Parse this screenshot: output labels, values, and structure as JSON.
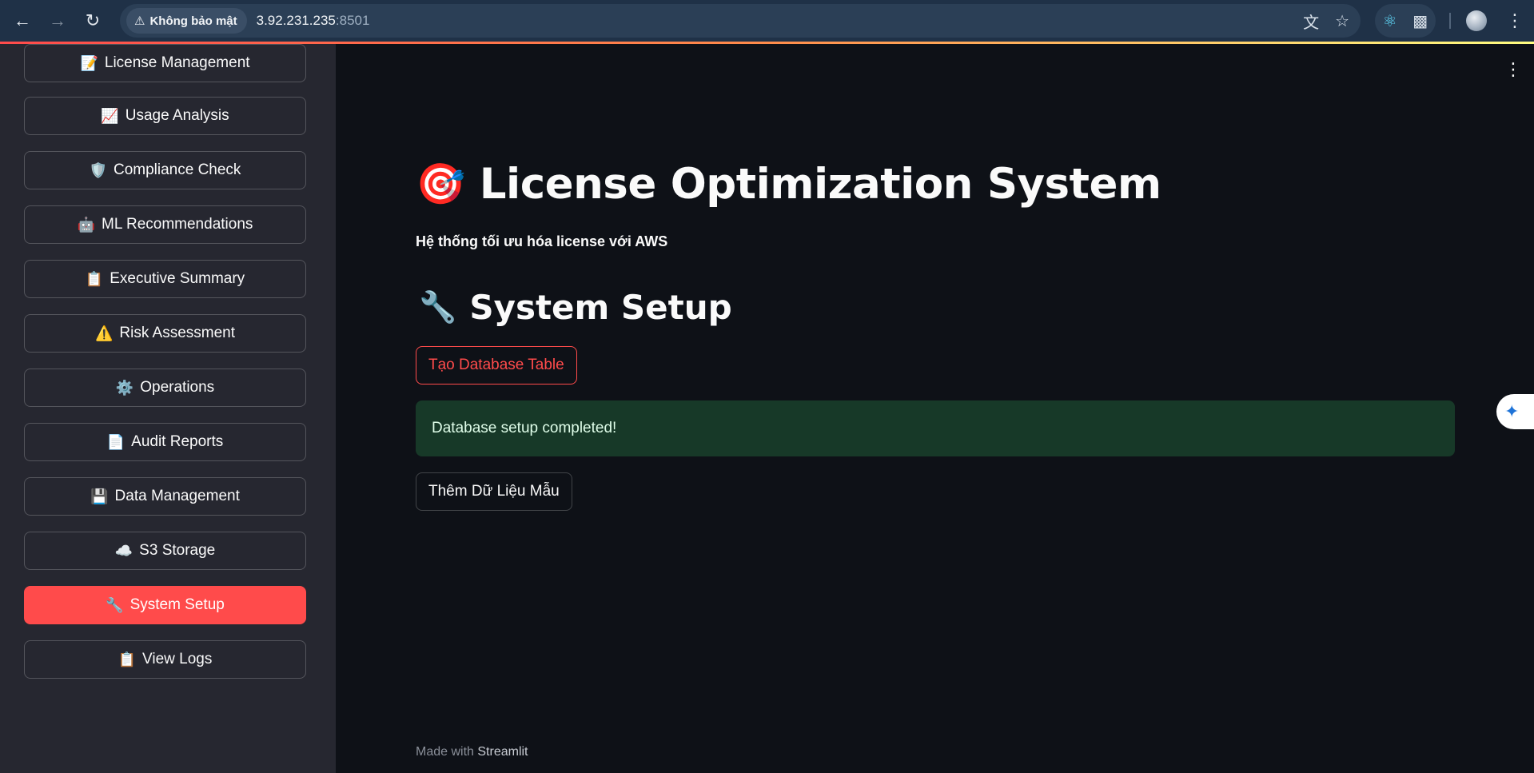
{
  "browser": {
    "security_label": "Không bảo mật",
    "url_host": "3.92.231.235",
    "url_port": ":8501",
    "icons": [
      "back-icon",
      "forward-icon",
      "reload-icon",
      "warning-icon",
      "translate-icon",
      "star-icon",
      "react-devtools-icon",
      "extensions-icon",
      "profile-avatar",
      "menu-dots-icon"
    ]
  },
  "sidebar": {
    "items": [
      {
        "emoji": "📝",
        "label": "License Management"
      },
      {
        "emoji": "📈",
        "label": "Usage Analysis"
      },
      {
        "emoji": "🛡️",
        "label": "Compliance Check"
      },
      {
        "emoji": "🤖",
        "label": "ML Recommendations"
      },
      {
        "emoji": "📋",
        "label": "Executive Summary"
      },
      {
        "emoji": "⚠️",
        "label": "Risk Assessment"
      },
      {
        "emoji": "⚙️",
        "label": "Operations"
      },
      {
        "emoji": "📄",
        "label": "Audit Reports"
      },
      {
        "emoji": "💾",
        "label": "Data Management"
      },
      {
        "emoji": "☁️",
        "label": "S3 Storage"
      },
      {
        "emoji": "🔧",
        "label": "System Setup",
        "active": true
      },
      {
        "emoji": "📋",
        "label": "View Logs"
      }
    ]
  },
  "main": {
    "title_emoji": "🎯",
    "title": "License Optimization System",
    "subtitle": "Hệ thống tối ưu hóa license với AWS",
    "section_emoji": "🔧",
    "section_title": "System Setup",
    "create_table_button": "Tạo Database Table",
    "success_message": "Database setup completed!",
    "sample_data_button": "Thêm Dữ Liệu Mẫu",
    "footer_prefix": "Made with ",
    "footer_brand": "Streamlit"
  },
  "colors": {
    "accent": "#ff4b4b",
    "background": "#0e1117",
    "sidebar": "#262730",
    "success_bg": "#173928"
  }
}
